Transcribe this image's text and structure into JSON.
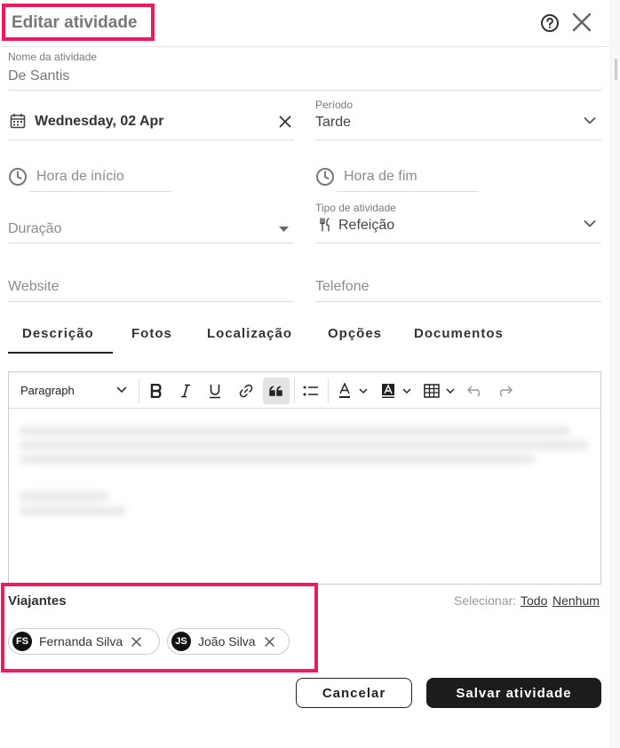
{
  "header": {
    "title": "Editar atividade"
  },
  "form": {
    "name": {
      "label": "Nome da atividade",
      "value": "De Santis"
    },
    "date": {
      "value": "Wednesday, 02 Apr"
    },
    "period": {
      "label": "Período",
      "value": "Tarde"
    },
    "start_time": {
      "placeholder": "Hora de início"
    },
    "end_time": {
      "placeholder": "Hora de fim"
    },
    "duration": {
      "placeholder": "Duração"
    },
    "activity_type": {
      "label": "Tipo de atividade",
      "value": "Refeição"
    },
    "website": {
      "placeholder": "Website"
    },
    "phone": {
      "placeholder": "Telefone"
    }
  },
  "tabs": [
    {
      "label": "Descrição",
      "active": true
    },
    {
      "label": "Fotos"
    },
    {
      "label": "Localização"
    },
    {
      "label": "Opções"
    },
    {
      "label": "Documentos"
    }
  ],
  "editor": {
    "block_format": "Paragraph"
  },
  "travelers": {
    "title": "Viajantes",
    "select_label": "Selecionar:",
    "select_all": "Todo",
    "select_none": "Nenhum",
    "items": [
      {
        "initials": "FS",
        "name": "Fernanda Silva"
      },
      {
        "initials": "JS",
        "name": "João Silva"
      }
    ]
  },
  "footer": {
    "cancel": "Cancelar",
    "save": "Salvar atividade"
  },
  "colors": {
    "highlight": "#f0185f",
    "primary_button": "#1c1c1c"
  }
}
